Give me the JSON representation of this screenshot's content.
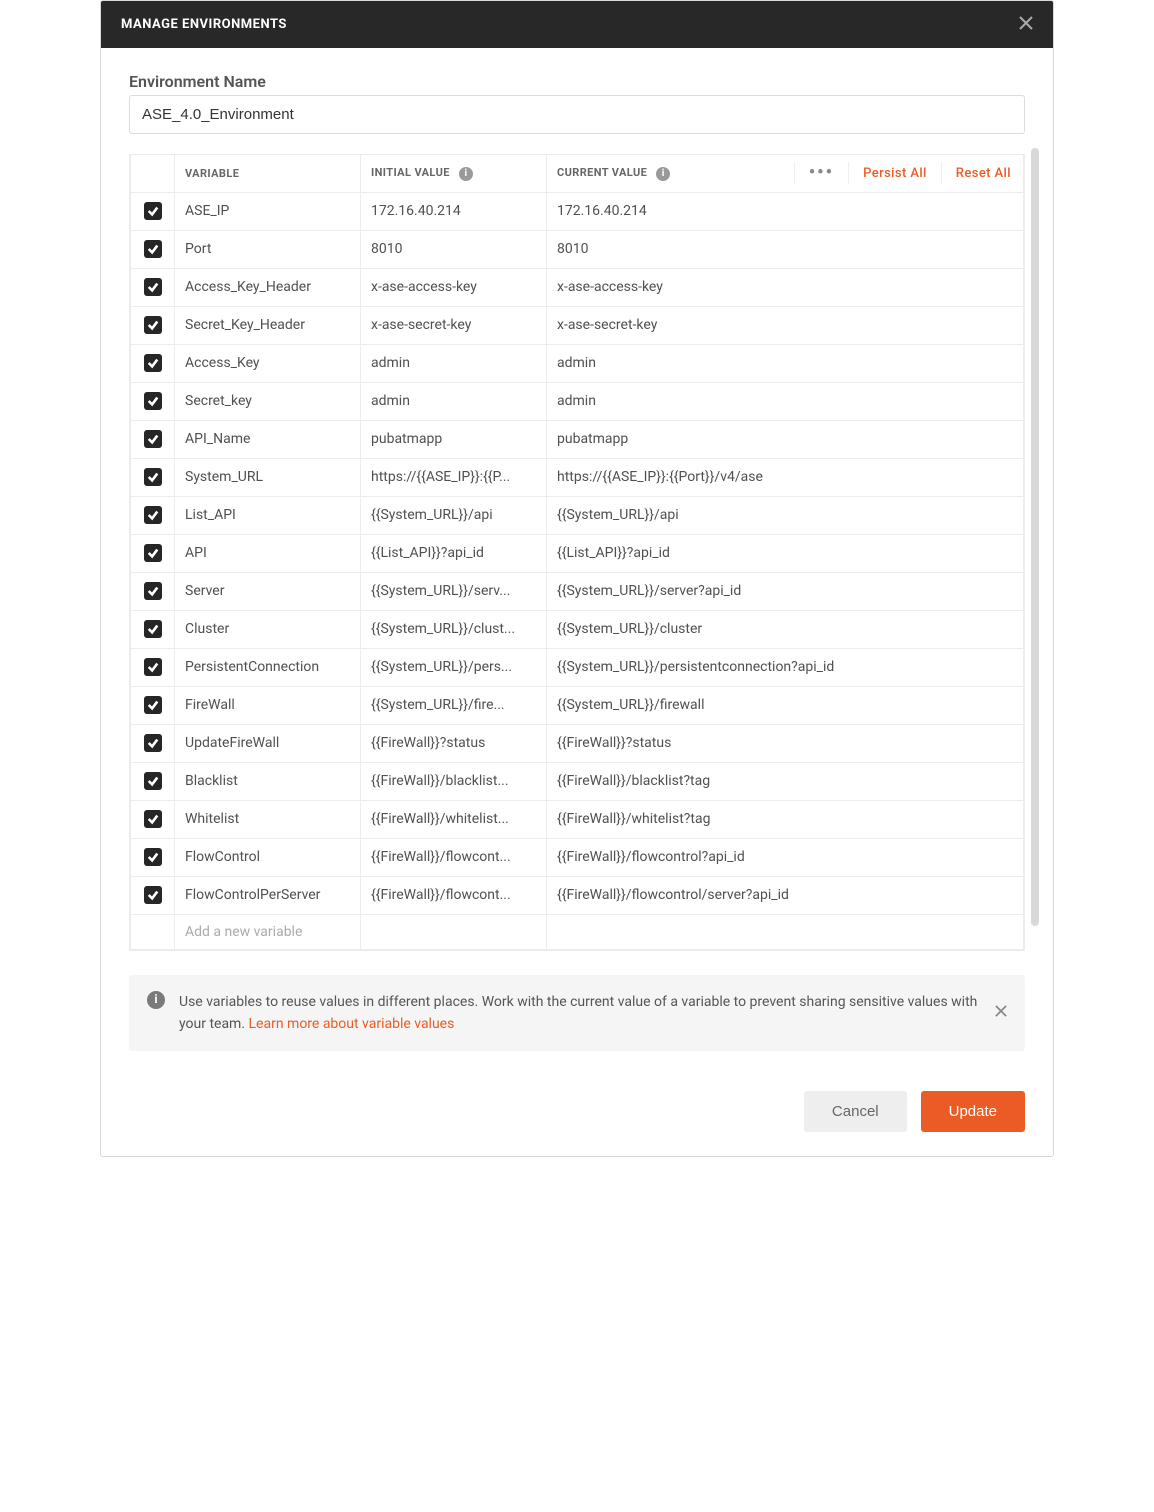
{
  "modal": {
    "title": "MANAGE ENVIRONMENTS"
  },
  "env_name": {
    "label": "Environment Name",
    "value": "ASE_4.0_Environment"
  },
  "columns": {
    "variable": "VARIABLE",
    "initial": "INITIAL VALUE",
    "current": "CURRENT VALUE"
  },
  "actions": {
    "persist_all": "Persist All",
    "reset_all": "Reset All"
  },
  "new_row_placeholder": "Add a new variable",
  "variables": [
    {
      "checked": true,
      "name": "ASE_IP",
      "initial": "172.16.40.214",
      "current": "172.16.40.214"
    },
    {
      "checked": true,
      "name": "Port",
      "initial": "8010",
      "current": "8010"
    },
    {
      "checked": true,
      "name": "Access_Key_Header",
      "initial": "x-ase-access-key",
      "current": "x-ase-access-key"
    },
    {
      "checked": true,
      "name": "Secret_Key_Header",
      "initial": "x-ase-secret-key",
      "current": "x-ase-secret-key"
    },
    {
      "checked": true,
      "name": "Access_Key",
      "initial": "admin",
      "current": "admin"
    },
    {
      "checked": true,
      "name": "Secret_key",
      "initial": "admin",
      "current": "admin"
    },
    {
      "checked": true,
      "name": "API_Name",
      "initial": "pubatmapp",
      "current": "pubatmapp"
    },
    {
      "checked": true,
      "name": "System_URL",
      "initial": "https://{{ASE_IP}}:{{P...",
      "current": "https://{{ASE_IP}}:{{Port}}/v4/ase"
    },
    {
      "checked": true,
      "name": "List_API",
      "initial": "{{System_URL}}/api",
      "current": "{{System_URL}}/api"
    },
    {
      "checked": true,
      "name": "API",
      "initial": "{{List_API}}?api_id",
      "current": "{{List_API}}?api_id"
    },
    {
      "checked": true,
      "name": "Server",
      "initial": "{{System_URL}}/serv...",
      "current": "{{System_URL}}/server?api_id"
    },
    {
      "checked": true,
      "name": "Cluster",
      "initial": "{{System_URL}}/clust...",
      "current": "{{System_URL}}/cluster"
    },
    {
      "checked": true,
      "name": "PersistentConnection",
      "initial": "{{System_URL}}/pers...",
      "current": "{{System_URL}}/persistentconnection?api_id"
    },
    {
      "checked": true,
      "name": "FireWall",
      "initial": "{{System_URL}}/fire...",
      "current": "{{System_URL}}/firewall"
    },
    {
      "checked": true,
      "name": "UpdateFireWall",
      "initial": "{{FireWall}}?status",
      "current": "{{FireWall}}?status"
    },
    {
      "checked": true,
      "name": "Blacklist",
      "initial": "{{FireWall}}/blacklist...",
      "current": "{{FireWall}}/blacklist?tag"
    },
    {
      "checked": true,
      "name": "Whitelist",
      "initial": "{{FireWall}}/whitelist...",
      "current": "{{FireWall}}/whitelist?tag"
    },
    {
      "checked": true,
      "name": "FlowControl",
      "initial": "{{FireWall}}/flowcont...",
      "current": "{{FireWall}}/flowcontrol?api_id"
    },
    {
      "checked": true,
      "name": "FlowControlPerServer",
      "initial": "{{FireWall}}/flowcont...",
      "current": "{{FireWall}}/flowcontrol/server?api_id"
    }
  ],
  "help": {
    "text": "Use variables to reuse values in different places. Work with the current value of a variable to prevent sharing sensitive values with your team. ",
    "link": "Learn more about variable values"
  },
  "footer": {
    "cancel": "Cancel",
    "update": "Update"
  }
}
